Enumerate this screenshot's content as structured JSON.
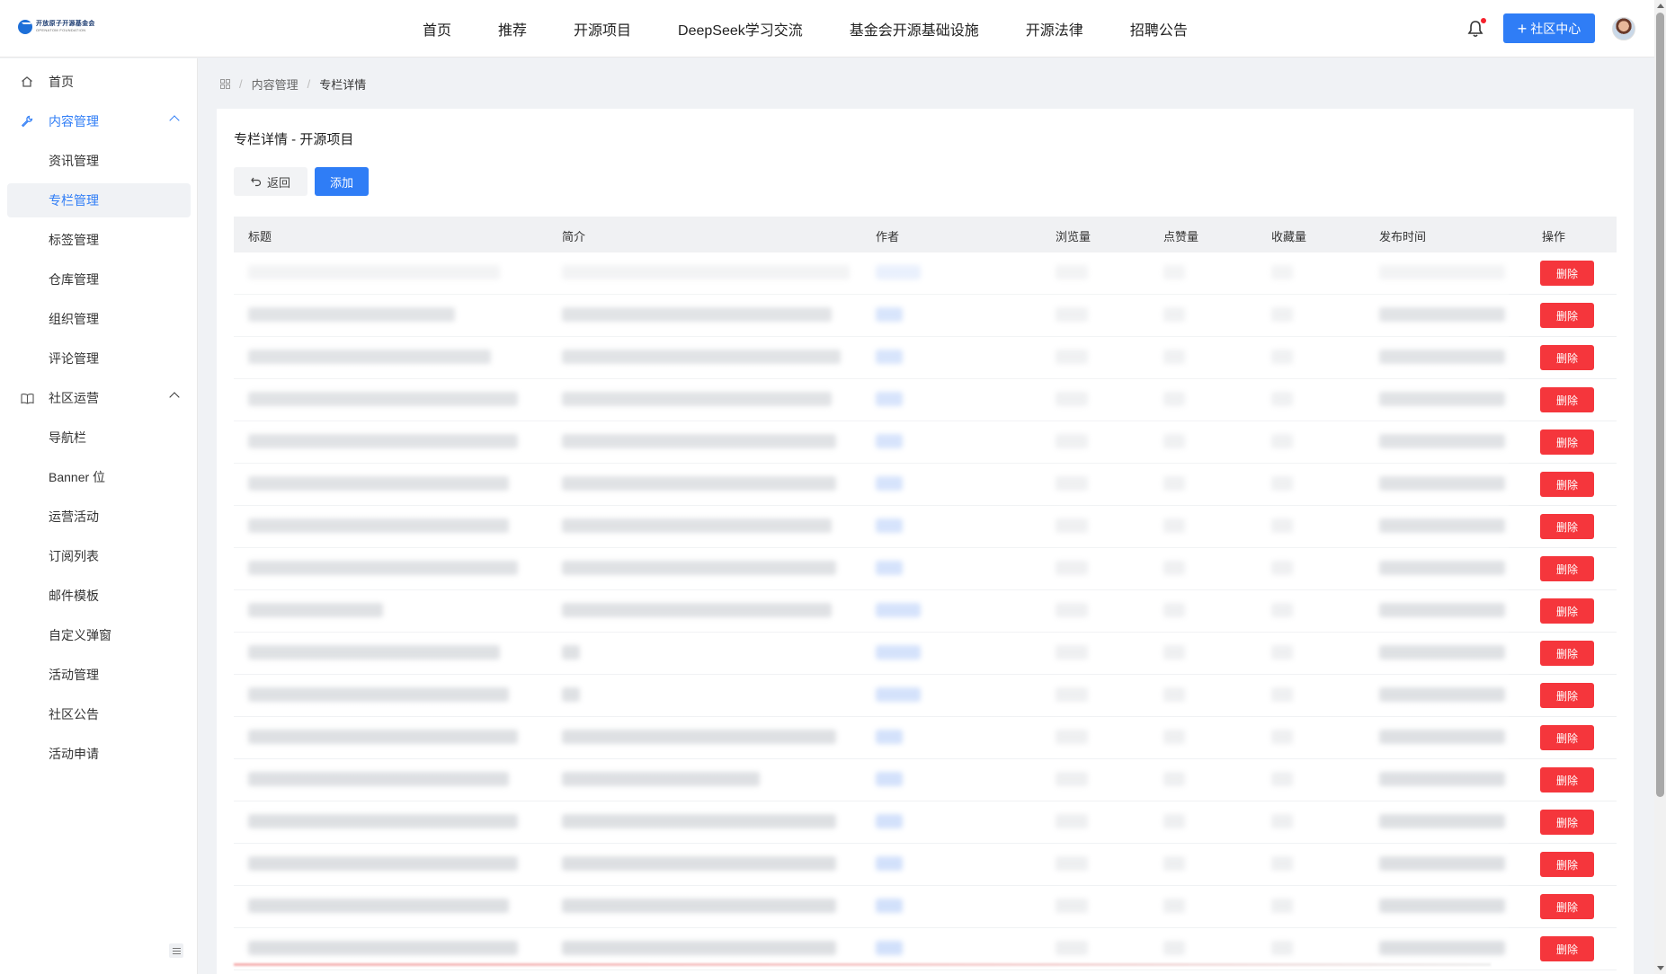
{
  "header": {
    "logo_text": "开放原子开源基金会",
    "logo_sub": "OPENATOM FOUNDATION",
    "nav": [
      "首页",
      "推荐",
      "开源项目",
      "DeepSeek学习交流",
      "基金会开源基础设施",
      "开源法律",
      "招聘公告"
    ],
    "community_button": "社区中心"
  },
  "sidebar": {
    "items": [
      {
        "label": "首页",
        "icon": "home-icon"
      },
      {
        "label": "内容管理",
        "icon": "wrench-icon"
      },
      {
        "label": "资讯管理"
      },
      {
        "label": "专栏管理"
      },
      {
        "label": "标签管理"
      },
      {
        "label": "仓库管理"
      },
      {
        "label": "组织管理"
      },
      {
        "label": "评论管理"
      },
      {
        "label": "社区运营",
        "icon": "book-icon"
      },
      {
        "label": "导航栏"
      },
      {
        "label": "Banner 位"
      },
      {
        "label": "运营活动"
      },
      {
        "label": "订阅列表"
      },
      {
        "label": "邮件模板"
      },
      {
        "label": "自定义弹窗"
      },
      {
        "label": "活动管理"
      },
      {
        "label": "社区公告"
      },
      {
        "label": "活动申请"
      }
    ]
  },
  "breadcrumb": {
    "items": [
      "内容管理",
      "专栏详情"
    ]
  },
  "page": {
    "title": "专栏详情 - 开源项目",
    "back_label": "返回",
    "add_label": "添加"
  },
  "table": {
    "headers": [
      "标题",
      "简介",
      "作者",
      "浏览量",
      "点赞量",
      "收藏量",
      "发布时间",
      "操作"
    ],
    "delete_label": "删除",
    "row_count": 17
  },
  "colors": {
    "primary": "#2f7df6",
    "danger": "#f5363c",
    "sidebar_selected_bg": "#f0f2f5"
  }
}
